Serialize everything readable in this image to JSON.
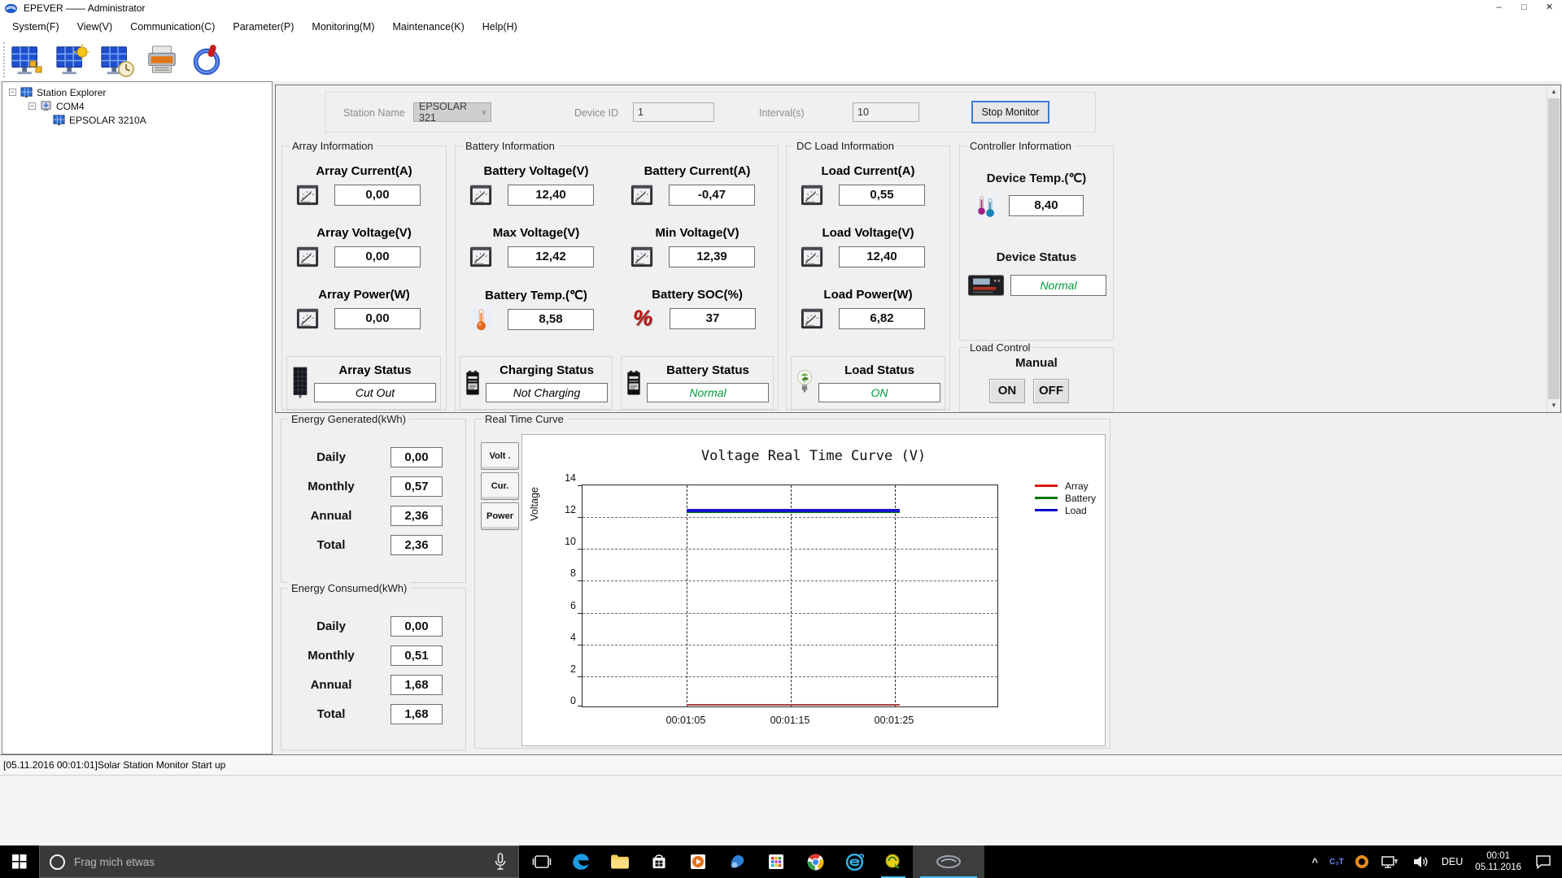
{
  "window": {
    "title": "EPEVER —— Administrator"
  },
  "menu": {
    "items": [
      "System(F)",
      "View(V)",
      "Communication(C)",
      "Parameter(P)",
      "Monitoring(M)",
      "Maintenance(K)",
      "Help(H)"
    ]
  },
  "tree": {
    "root_label": "Station Explorer",
    "port_label": "COM4",
    "device_label": "EPSOLAR 3210A"
  },
  "station_bar": {
    "station_name_label": "Station Name",
    "station_name_value": "EPSOLAR 321",
    "device_id_label": "Device ID",
    "device_id_value": "1",
    "interval_label": "Interval(s)",
    "interval_value": "10",
    "stop_button_label": "Stop Monitor"
  },
  "groups": {
    "array": {
      "title": "Array Information",
      "metrics": [
        {
          "label": "Array Current(A)",
          "value": "0,00"
        },
        {
          "label": "Array Voltage(V)",
          "value": "0,00"
        },
        {
          "label": "Array Power(W)",
          "value": "0,00"
        }
      ],
      "status": {
        "title": "Array Status",
        "value": "Cut Out",
        "value_color": "#000000"
      }
    },
    "battery": {
      "title": "Battery Information",
      "metrics": [
        {
          "label": "Battery Voltage(V)",
          "value": "12,40"
        },
        {
          "label": "Battery Current(A)",
          "value": "-0,47"
        },
        {
          "label": "Max Voltage(V)",
          "value": "12,42"
        },
        {
          "label": "Min Voltage(V)",
          "value": "12,39"
        },
        {
          "label": "Battery Temp.(℃)",
          "value": "8,58"
        },
        {
          "label": "Battery SOC(%)",
          "value": "37"
        }
      ],
      "charging_status": {
        "title": "Charging Status",
        "value": "Not Charging",
        "value_color": "#000000"
      },
      "battery_status": {
        "title": "Battery Status",
        "value": "Normal",
        "value_color": "#009a3c"
      }
    },
    "dc_load": {
      "title": "DC Load Information",
      "metrics": [
        {
          "label": "Load Current(A)",
          "value": "0,55"
        },
        {
          "label": "Load Voltage(V)",
          "value": "12,40"
        },
        {
          "label": "Load Power(W)",
          "value": "6,82"
        }
      ],
      "status": {
        "title": "Load Status",
        "value": "ON",
        "value_color": "#009a3c"
      }
    },
    "controller": {
      "title": "Controller Information",
      "temp_label": "Device Temp.(℃)",
      "temp_value": "8,40",
      "status_label": "Device Status",
      "status_value": "Normal",
      "status_color": "#009a3c"
    },
    "load_control": {
      "title": "Load Control",
      "mode_label": "Manual",
      "on_label": "ON",
      "off_label": "OFF"
    }
  },
  "energy_generated": {
    "title": "Energy Generated(kWh)",
    "rows": [
      {
        "label": "Daily",
        "value": "0,00"
      },
      {
        "label": "Monthly",
        "value": "0,57"
      },
      {
        "label": "Annual",
        "value": "2,36"
      },
      {
        "label": "Total",
        "value": "2,36"
      }
    ]
  },
  "energy_consumed": {
    "title": "Energy Consumed(kWh)",
    "rows": [
      {
        "label": "Daily",
        "value": "0,00"
      },
      {
        "label": "Monthly",
        "value": "0,51"
      },
      {
        "label": "Annual",
        "value": "1,68"
      },
      {
        "label": "Total",
        "value": "1,68"
      }
    ]
  },
  "curve_panel": {
    "title": "Real Time Curve",
    "tabs": [
      "Volt .",
      "Cur.",
      "Power"
    ],
    "chart_title": "Voltage Real Time Curve (V)",
    "y_axis_label": "Voltage",
    "y_ticks": [
      "14",
      "12",
      "10",
      "8",
      "6",
      "4",
      "2",
      "0"
    ],
    "x_ticks": [
      "00:01:05",
      "00:01:15",
      "00:01:25"
    ],
    "legend": [
      {
        "label": "Array",
        "color": "#dd1111"
      },
      {
        "label": "Battery",
        "color": "#007700"
      },
      {
        "label": "Load",
        "color": "#0000cc"
      }
    ]
  },
  "chart_data": {
    "type": "line",
    "title": "Voltage Real Time Curve (V)",
    "ylabel": "Voltage",
    "ylim": [
      0,
      14
    ],
    "x": [
      "00:01:05",
      "00:01:15",
      "00:01:25"
    ],
    "series": [
      {
        "name": "Array",
        "color": "#dd1111",
        "values": [
          0.0,
          0.0,
          0.0
        ]
      },
      {
        "name": "Battery",
        "color": "#007700",
        "values": [
          12.4,
          12.4,
          12.4
        ]
      },
      {
        "name": "Load",
        "color": "#0000cc",
        "values": [
          12.4,
          12.4,
          12.4
        ]
      }
    ],
    "grid": "dashed",
    "legend_position": "right"
  },
  "log": {
    "entry": "[05.11.2016 00:01:01]Solar Station Monitor Start up"
  },
  "taskbar": {
    "search_placeholder": "Frag mich etwas",
    "language": "DEU",
    "clock_time": "00:01",
    "clock_date": "05.11.2016"
  },
  "glyphs": {
    "dropdown_chevron": "∨",
    "tray_chevron": "^",
    "collapse_box": "−",
    "win_min": "–",
    "win_max": "□",
    "win_close": "✕",
    "scroll_up": "▲",
    "scroll_down": "▼",
    "soc_percent": "%",
    "c2t": "C₂T"
  }
}
